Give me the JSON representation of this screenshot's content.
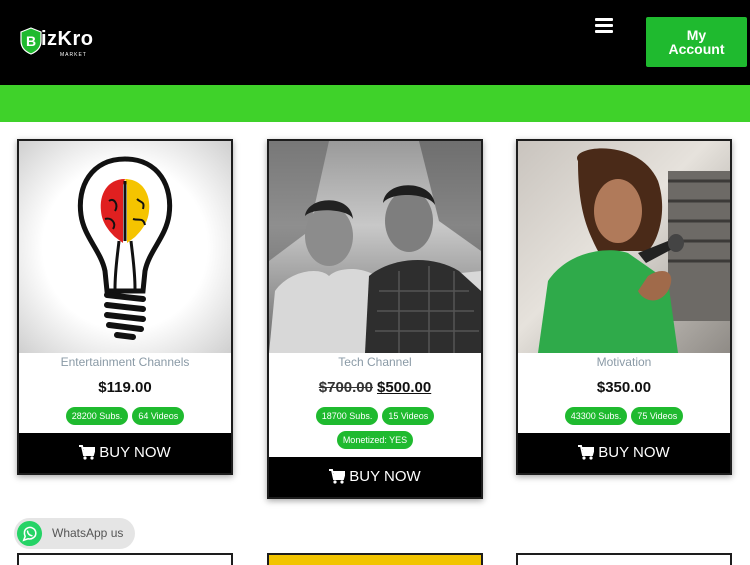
{
  "header": {
    "logo_text": "izKro",
    "logo_letter": "B",
    "logo_sub": "MARKET",
    "account_line1": "My",
    "account_line2": "Account"
  },
  "colors": {
    "accent": "#1fba2f",
    "banner": "#3fd22a",
    "header_bg": "#000000"
  },
  "products": [
    {
      "category": "Entertainment Channels",
      "old_price": "",
      "price": "$119.00",
      "badges": [
        "28200 Subs.",
        "64 Videos"
      ],
      "buy_label": "BUY NOW"
    },
    {
      "category": "Tech Channel",
      "old_price": "$700.00",
      "price": "$500.00",
      "badges": [
        "18700 Subs.",
        "15 Videos",
        "Monetized: YES"
      ],
      "buy_label": "BUY NOW"
    },
    {
      "category": "Motivation",
      "old_price": "",
      "price": "$350.00",
      "badges": [
        "43300 Subs.",
        "75 Videos"
      ],
      "buy_label": "BUY NOW"
    }
  ],
  "whatsapp": {
    "label": "WhatsApp us",
    "icon": "whatsapp-icon"
  }
}
